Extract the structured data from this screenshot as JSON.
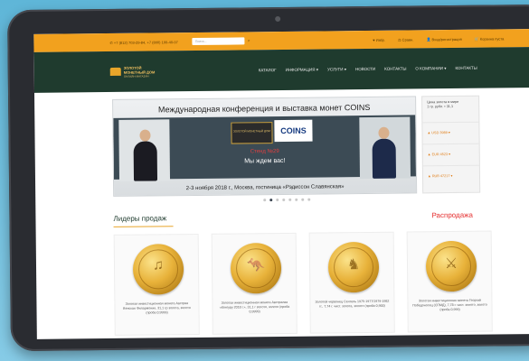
{
  "topbar": {
    "phones": "✆ +7 (812) 703-29-84, +7 (800) 100-40-97",
    "search_placeholder": "Поиск...",
    "links": [
      "♥ Избр.",
      "⚖ Сравн.",
      "👤 Вход/регистрация",
      "🛒 Корзина пуста"
    ]
  },
  "logo": {
    "line1": "ЗОЛОТОЙ",
    "line2": "МОНЕТНЫЙ ДОМ",
    "sub": "ОНЛАЙН-МАГАЗИН"
  },
  "nav": [
    "КАТАЛОГ",
    "ИНФОРМАЦИЯ ▾",
    "УСЛУГИ ▾",
    "НОВОСТИ",
    "КОНТАКТЫ",
    "О КОМПАНИИ ▾",
    "КОНТАКТЫ"
  ],
  "banner": {
    "title": "Международная конференция и выставка монет COINS",
    "booth": "ЗОЛОТОЙ МОНЕТНЫЙ ДОМ",
    "coins_logo": "COINS",
    "stand": "Стенд №29",
    "welcome": "Мы ждем вас!",
    "footer": "2-3 ноября 2018 г., Москва, гостиница «Рэдиссон Славянская»"
  },
  "carousel": {
    "count": 8,
    "active": 1
  },
  "rates": {
    "header": "Цена золота в мире",
    "sub": "1 гр. рубл. • 31,1",
    "items": [
      "▲ USD 3989 ▾",
      "▲ EUR 4523 ▾",
      "▲ RUB 47217 ▾"
    ]
  },
  "sections": {
    "leaders": "Лидеры продаж",
    "sale": "Распродажа"
  },
  "products": [
    {
      "glyph": "♫",
      "desc": "Золотая инвестиционная монета Австрии Венская Филармония, 31,1 гр золота, золото (проба 0,9999)"
    },
    {
      "glyph": "🦘",
      "desc": "Золотая инвестиционная монета Австралии «Кенгуру 2018 г.», 31,1 г золото, золото (проба 0,9999)"
    },
    {
      "glyph": "♞",
      "desc": "Золотой червонец Сеятель 1975-1977/1979-1982 гг., 7,74 г. чист. золота, золото (проба 0,900)"
    },
    {
      "glyph": "⚔",
      "desc": "Золотая инвестиционная монета Георгий Победоносец (СПМД), 7,78 г. чист. золото, золото (проба 0,999)"
    }
  ]
}
